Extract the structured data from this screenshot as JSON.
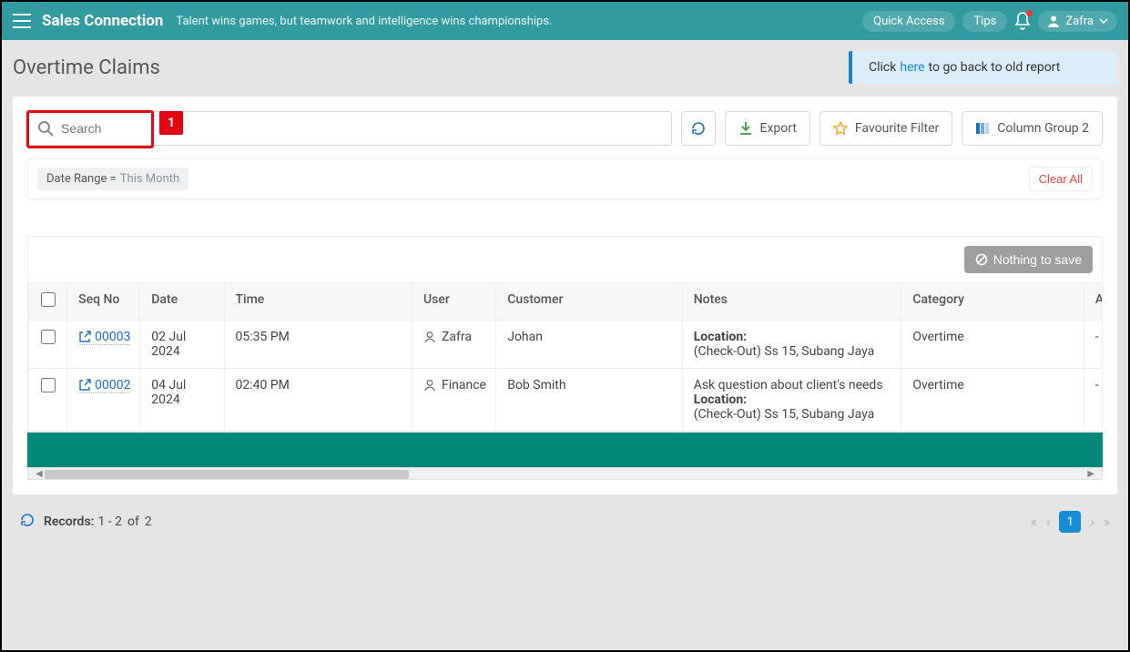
{
  "topbar": {
    "brand": "Sales Connection",
    "tagline": "Talent wins games, but teamwork and intelligence wins championships.",
    "quick_access": "Quick Access",
    "tips": "Tips",
    "username": "Zafra"
  },
  "page_title": "Overtime Claims",
  "banner": {
    "pre": "Click",
    "link": "here",
    "post": "to go back to old report"
  },
  "toolbar": {
    "search_placeholder": "Search",
    "export": "Export",
    "favourite": "Favourite Filter",
    "column_group": "Column Group 2"
  },
  "callout_number": "1",
  "filter": {
    "label": "Date Range =",
    "value": "This Month",
    "clear": "Clear All"
  },
  "save_btn": "Nothing to save",
  "columns": {
    "seq": "Seq No",
    "date": "Date",
    "time": "Time",
    "user": "User",
    "customer": "Customer",
    "notes": "Notes",
    "category": "Category",
    "extra": "A"
  },
  "rows": [
    {
      "seq": "00003",
      "date": "02 Jul 2024",
      "time": "05:35 PM",
      "user": "Zafra",
      "customer": "Johan",
      "notes_pre": "",
      "notes_loc_label": "Location:",
      "notes_loc_val": "(Check-Out) Ss 15, Subang Jaya",
      "category": "Overtime",
      "extra": "-"
    },
    {
      "seq": "00002",
      "date": "04 Jul 2024",
      "time": "02:40 PM",
      "user": "Finance",
      "customer": "Bob Smith",
      "notes_pre": "Ask question about client's needs",
      "notes_loc_label": "Location:",
      "notes_loc_val": "(Check-Out) Ss 15, Subang Jaya",
      "category": "Overtime",
      "extra": "-"
    }
  ],
  "pager": {
    "records_label": "Records:",
    "records_range": "1 - 2",
    "of": "of",
    "total": "2",
    "page": "1"
  }
}
